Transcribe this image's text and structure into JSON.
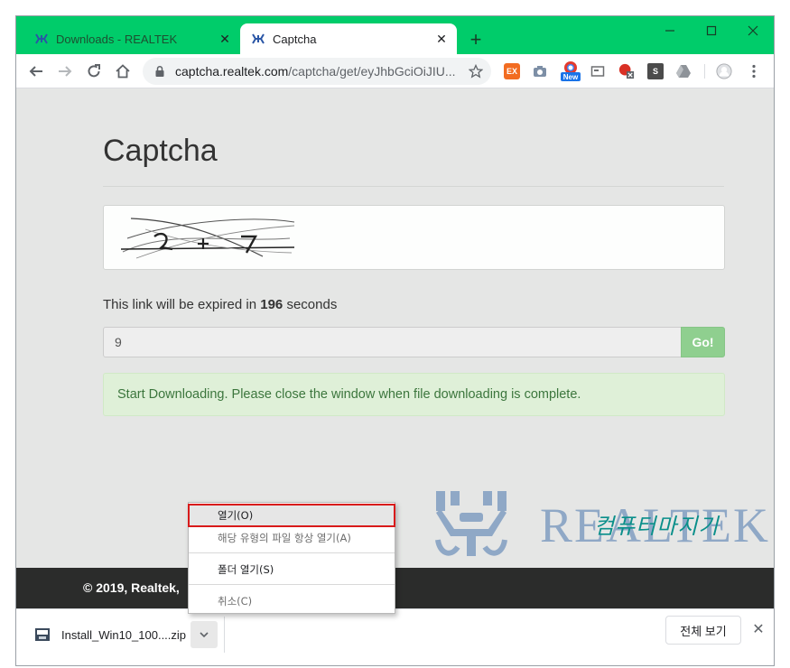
{
  "browser": {
    "tabs": [
      {
        "title": "Downloads - REALTEK",
        "active": false
      },
      {
        "title": "Captcha",
        "active": true
      }
    ],
    "new_tab_symbol": "+",
    "window_controls": [
      "minimize-icon",
      "maximize-icon",
      "close-icon"
    ],
    "url_host": "captcha.realtek.com",
    "url_path": "/captcha/get/eyJhbGciOiJIU...",
    "extension_badge_new": "New",
    "extension_ex_label": "EX",
    "extension_s_label": "S",
    "accent_color": "#00cc6a"
  },
  "page": {
    "title": "Captcha",
    "expiry_prefix": "This link will be expired in",
    "expiry_seconds": "196",
    "expiry_suffix": "seconds",
    "code_value": "9",
    "go_label": "Go!",
    "alert_text": "Start Downloading. Please close the window when file downloading is complete.",
    "logo_text": "REALTEK",
    "footer_text": "© 2019, Realtek,",
    "watermark_text": "컴퓨터마지기"
  },
  "download_shelf": {
    "file_name": "Install_Win10_100....zip",
    "show_all_label": "전체 보기"
  },
  "context_menu": {
    "items": [
      {
        "label": "열기(O)",
        "highlighted": true
      },
      {
        "label": "해당 유형의 파일 항상 열기(A)",
        "highlighted": false
      },
      {
        "label": "폴더 열기(S)",
        "highlighted": false
      },
      {
        "label": "취소(C)",
        "highlighted": false
      }
    ]
  }
}
